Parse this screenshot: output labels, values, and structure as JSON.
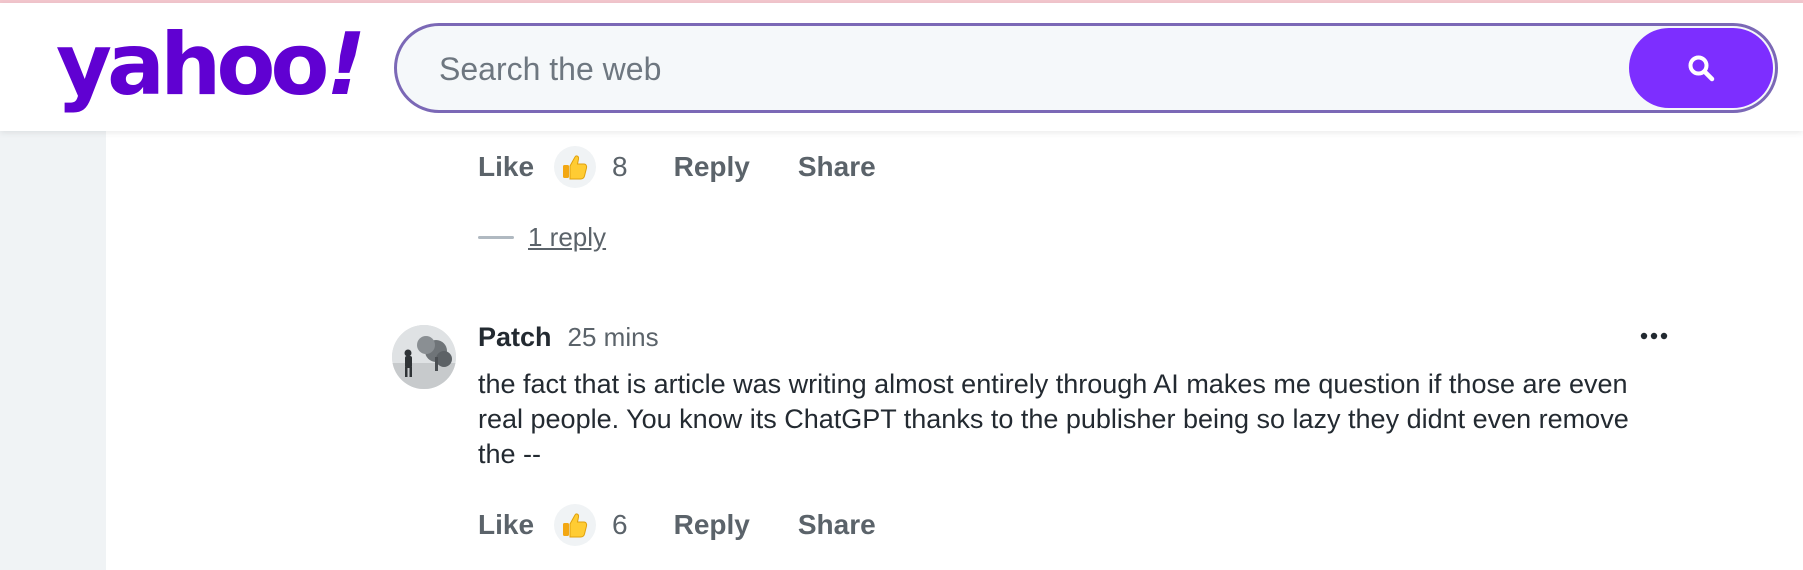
{
  "header": {
    "logo_text": "yahoo",
    "logo_mark": "!",
    "search": {
      "placeholder": "Search the web",
      "value": "",
      "button_icon": "search-icon"
    }
  },
  "previous_comment": {
    "actions": {
      "like_label": "Like",
      "like_icon": "thumbs-up-icon",
      "like_count": "8",
      "reply_label": "Reply",
      "share_label": "Share"
    },
    "replies_toggle": "1 reply"
  },
  "comment": {
    "author": "Patch",
    "time": "25 mins",
    "more_icon": "more-options-icon",
    "text": "the fact that is article was writing almost entirely through AI makes me question if those are even real people. You know its ChatGPT thanks to the publisher being so lazy they didnt even remove the --",
    "actions": {
      "like_label": "Like",
      "like_icon": "thumbs-up-icon",
      "like_count": "6",
      "reply_label": "Reply",
      "share_label": "Share"
    }
  },
  "colors": {
    "brand": "#6001d2",
    "search_button": "#7d2eff",
    "search_border": "#7b68b6",
    "text_primary": "#232a31",
    "text_secondary": "#5b636a",
    "rail": "#f0f3f5"
  }
}
